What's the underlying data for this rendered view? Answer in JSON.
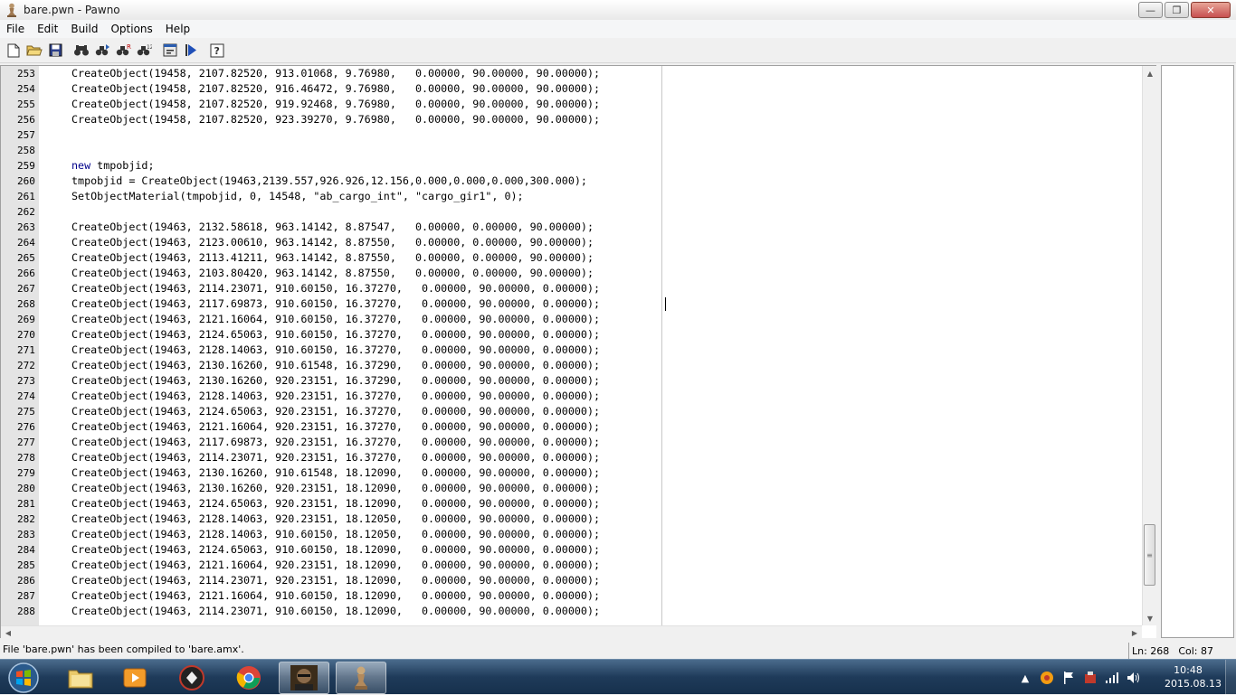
{
  "window": {
    "title": "bare.pwn - Pawno",
    "minimize_glyph": "—",
    "maximize_glyph": "❐",
    "close_glyph": "✕"
  },
  "menu": [
    "File",
    "Edit",
    "Build",
    "Options",
    "Help"
  ],
  "toolbar_icons": [
    "new-file-icon",
    "open-folder-icon",
    "save-icon",
    "find-icon",
    "find-next-icon",
    "replace-icon",
    "goto-line-icon",
    "compile-icon",
    "run-icon",
    "help-icon"
  ],
  "editor": {
    "line_numbers": [
      "253",
      "254",
      "255",
      "256",
      "257",
      "258",
      "259",
      "260",
      "261",
      "262",
      "263",
      "264",
      "265",
      "266",
      "267",
      "268",
      "269",
      "270",
      "271",
      "272",
      "273",
      "274",
      "275",
      "276",
      "277",
      "278",
      "279",
      "280",
      "281",
      "282",
      "283",
      "284",
      "285",
      "286",
      "287",
      "288"
    ],
    "lines": [
      "CreateObject(19458, 2107.82520, 913.01068, 9.76980,   0.00000, 90.00000, 90.00000);",
      "CreateObject(19458, 2107.82520, 916.46472, 9.76980,   0.00000, 90.00000, 90.00000);",
      "CreateObject(19458, 2107.82520, 919.92468, 9.76980,   0.00000, 90.00000, 90.00000);",
      "CreateObject(19458, 2107.82520, 923.39270, 9.76980,   0.00000, 90.00000, 90.00000);",
      "",
      "",
      "new tmpobjid;",
      "tmpobjid = CreateObject(19463,2139.557,926.926,12.156,0.000,0.000,0.000,300.000);",
      "SetObjectMaterial(tmpobjid, 0, 14548, \"ab_cargo_int\", \"cargo_gir1\", 0);",
      "",
      "CreateObject(19463, 2132.58618, 963.14142, 8.87547,   0.00000, 0.00000, 90.00000);",
      "CreateObject(19463, 2123.00610, 963.14142, 8.87550,   0.00000, 0.00000, 90.00000);",
      "CreateObject(19463, 2113.41211, 963.14142, 8.87550,   0.00000, 0.00000, 90.00000);",
      "CreateObject(19463, 2103.80420, 963.14142, 8.87550,   0.00000, 0.00000, 90.00000);",
      "CreateObject(19463, 2114.23071, 910.60150, 16.37270,   0.00000, 90.00000, 0.00000);",
      "CreateObject(19463, 2117.69873, 910.60150, 16.37270,   0.00000, 90.00000, 0.00000);",
      "CreateObject(19463, 2121.16064, 910.60150, 16.37270,   0.00000, 90.00000, 0.00000);",
      "CreateObject(19463, 2124.65063, 910.60150, 16.37270,   0.00000, 90.00000, 0.00000);",
      "CreateObject(19463, 2128.14063, 910.60150, 16.37270,   0.00000, 90.00000, 0.00000);",
      "CreateObject(19463, 2130.16260, 910.61548, 16.37290,   0.00000, 90.00000, 0.00000);",
      "CreateObject(19463, 2130.16260, 920.23151, 16.37290,   0.00000, 90.00000, 0.00000);",
      "CreateObject(19463, 2128.14063, 920.23151, 16.37270,   0.00000, 90.00000, 0.00000);",
      "CreateObject(19463, 2124.65063, 920.23151, 16.37270,   0.00000, 90.00000, 0.00000);",
      "CreateObject(19463, 2121.16064, 920.23151, 16.37270,   0.00000, 90.00000, 0.00000);",
      "CreateObject(19463, 2117.69873, 920.23151, 16.37270,   0.00000, 90.00000, 0.00000);",
      "CreateObject(19463, 2114.23071, 920.23151, 16.37270,   0.00000, 90.00000, 0.00000);",
      "CreateObject(19463, 2130.16260, 910.61548, 18.12090,   0.00000, 90.00000, 0.00000);",
      "CreateObject(19463, 2130.16260, 920.23151, 18.12090,   0.00000, 90.00000, 0.00000);",
      "CreateObject(19463, 2124.65063, 920.23151, 18.12090,   0.00000, 90.00000, 0.00000);",
      "CreateObject(19463, 2128.14063, 920.23151, 18.12050,   0.00000, 90.00000, 0.00000);",
      "CreateObject(19463, 2128.14063, 910.60150, 18.12050,   0.00000, 90.00000, 0.00000);",
      "CreateObject(19463, 2124.65063, 910.60150, 18.12090,   0.00000, 90.00000, 0.00000);",
      "CreateObject(19463, 2121.16064, 920.23151, 18.12090,   0.00000, 90.00000, 0.00000);",
      "CreateObject(19463, 2114.23071, 920.23151, 18.12090,   0.00000, 90.00000, 0.00000);",
      "CreateObject(19463, 2121.16064, 910.60150, 18.12090,   0.00000, 90.00000, 0.00000);",
      "CreateObject(19463, 2114.23071, 910.60150, 18.12090,   0.00000, 90.00000, 0.00000);"
    ]
  },
  "status": {
    "message": "File 'bare.pwn' has been compiled to 'bare.amx'.",
    "line": "Ln: 268",
    "col": "Col: 87"
  },
  "taskbar": {
    "clock_time": "10:48",
    "clock_date": "2015.08.13",
    "tasks": [
      "file-explorer-icon",
      "media-player-icon",
      "tool-app-icon",
      "chrome-icon",
      "game-avatar-icon",
      "pawno-icon"
    ]
  },
  "colors": {
    "keyword": "#00008b",
    "gutter": "#e4e4e4",
    "taskbar": "#1f3b5a"
  }
}
